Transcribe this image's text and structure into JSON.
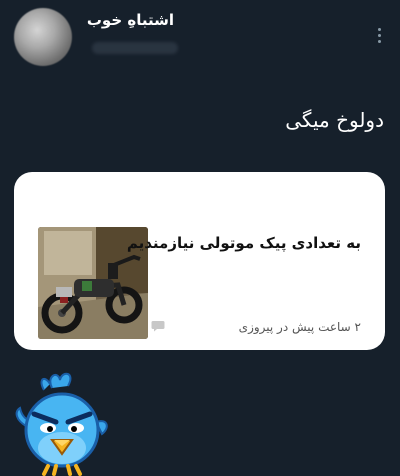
{
  "post": {
    "author_name": "اشتباهِ خوب",
    "text": "دولوخ میگی"
  },
  "card": {
    "title": "به تعدادی پیک موتولی نیازمندیم",
    "meta": "۲ ساعت پیش در پیروزی"
  },
  "icons": {
    "avatar": "avatar",
    "more": "more-vertical-icon",
    "comment": "comment-icon",
    "thumbnail": "motorcycle-photo",
    "sticker": "angry-blue-bird-sticker"
  },
  "colors": {
    "background": "#16202b",
    "card": "#ffffff",
    "text": "#ffffff",
    "card_title": "#111111",
    "card_meta": "#555555"
  }
}
